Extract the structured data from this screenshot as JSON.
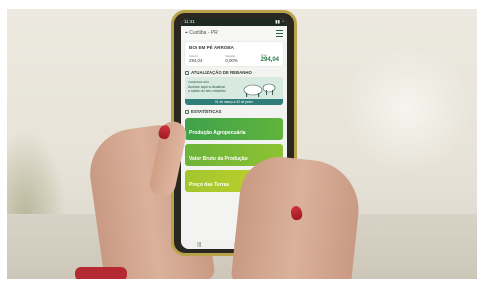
{
  "status_bar": {
    "time": "11:31",
    "icons": "signal-wifi-battery"
  },
  "header": {
    "location": "Curitiba - PR",
    "location_icon": "map-pin-icon",
    "menu_icon": "menu-icon"
  },
  "price_card": {
    "title": "BOI EM PÉ ARROBA",
    "columns": [
      {
        "label": "Anterior",
        "value": "294,04"
      },
      {
        "label": "Variação",
        "value": "0,00%"
      },
      {
        "label": "Atual",
        "value": "294,04"
      }
    ]
  },
  "herd_section": {
    "title": "ATUALIZAÇÃO DE REBANHO",
    "banner_small": "CAMPANHA 2023",
    "banner_text": "Acesse aqui a atualizar o saldo do seu rebanho",
    "banner_strip": "01 de março a 30 de junho"
  },
  "stats_section": {
    "title": "ESTATÍSTICAS",
    "buttons": [
      "Produção Agropecuária",
      "Valor Bruto da Produção",
      "Preço das Terras"
    ]
  },
  "colors": {
    "frame": "#b8a34a",
    "accent_green": "#1f7a44",
    "nail_red": "#c0262f"
  }
}
